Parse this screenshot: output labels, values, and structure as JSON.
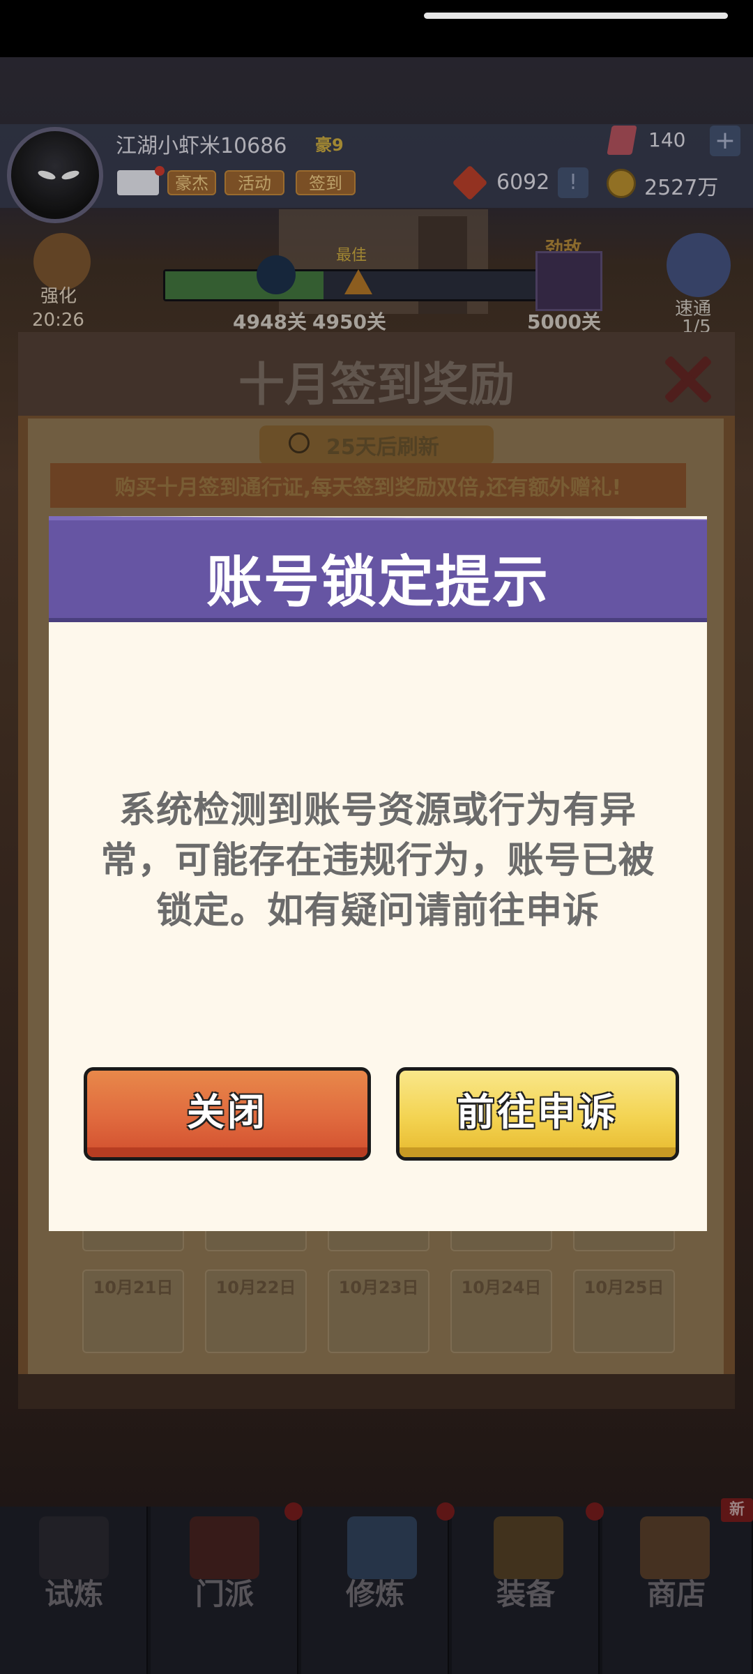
{
  "player": {
    "name": "江湖小虾米10686",
    "vip": "豪9"
  },
  "header_tags": [
    "豪杰",
    "活动",
    "签到"
  ],
  "currency": {
    "gems": "140",
    "tokens": "6092",
    "gold": "2527万"
  },
  "progress": {
    "enhance_label": "强化",
    "enhance_timer": "20:26",
    "best_label": "最佳",
    "current_stage": "4948关",
    "best_stage": "4950关",
    "boss_label": "劲敌",
    "boss_stage": "5000关",
    "fill_fraction": 0.42,
    "sweep_label": "速通",
    "sweep_count": "1/5"
  },
  "signin": {
    "title": "十月签到奖励",
    "refresh": "25天后刷新",
    "pass_text": "购买十月签到通行证,每天签到奖励双倍,还有额外赠礼!",
    "days": [
      "10月21日",
      "10月22日",
      "10月23日",
      "10月24日",
      "10月25日"
    ]
  },
  "modal": {
    "title": "账号锁定提示",
    "message": "系统检测到账号资源或行为有异常，可能存在违规行为，账号已被锁定。如有疑问请前往申诉",
    "close_label": "关闭",
    "appeal_label": "前往申诉"
  },
  "bottom_nav": {
    "items": [
      {
        "label": "试炼"
      },
      {
        "label": "门派"
      },
      {
        "label": "修炼"
      },
      {
        "label": "装备"
      },
      {
        "label": "商店"
      }
    ],
    "new_badge": "新"
  },
  "colors": {
    "modal_header": "#6655a3",
    "modal_body": "#fef8ec",
    "close_button": "#e06a3e",
    "appeal_button": "#f3d351"
  }
}
